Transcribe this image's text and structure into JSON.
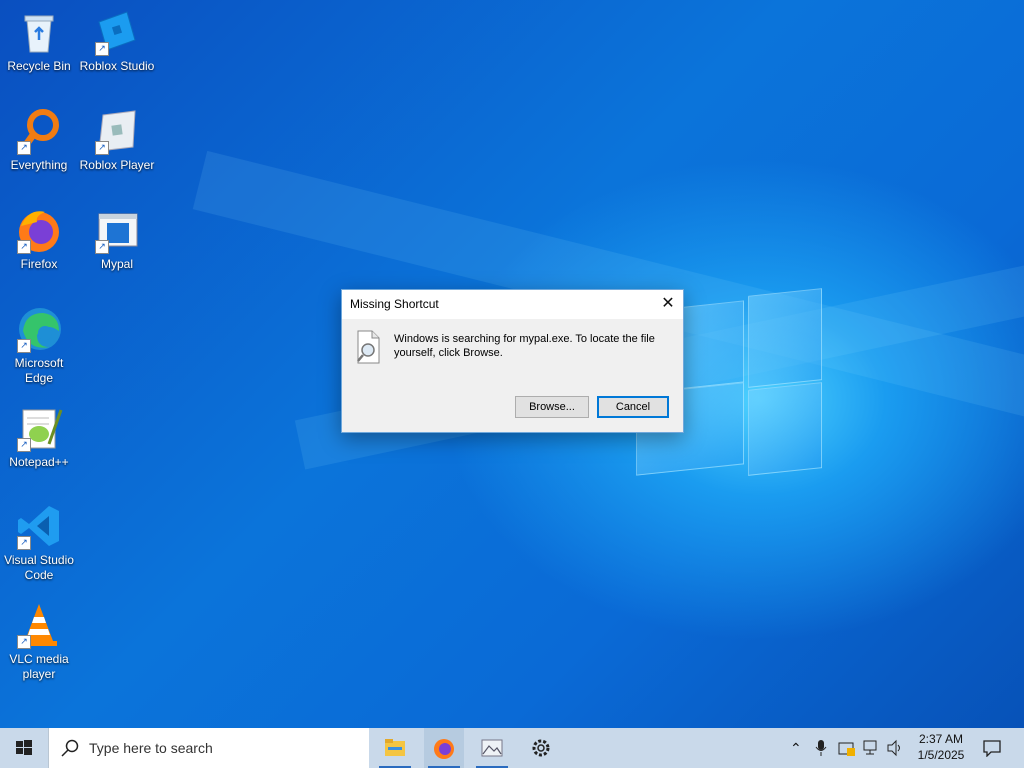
{
  "desktop_icons": [
    {
      "label": "Recycle Bin",
      "icon": "recycle-bin-icon"
    },
    {
      "label": "Roblox Studio",
      "icon": "roblox-studio-icon"
    },
    {
      "label": "Everything",
      "icon": "everything-icon"
    },
    {
      "label": "Roblox Player",
      "icon": "roblox-player-icon"
    },
    {
      "label": "Firefox",
      "icon": "firefox-icon"
    },
    {
      "label": "Mypal",
      "icon": "mypal-icon"
    },
    {
      "label": "Microsoft Edge",
      "icon": "edge-icon"
    },
    {
      "label": "Notepad++",
      "icon": "notepadpp-icon"
    },
    {
      "label": "Visual Studio Code",
      "icon": "vscode-icon"
    },
    {
      "label": "VLC media player",
      "icon": "vlc-icon"
    }
  ],
  "dialog": {
    "title": "Missing Shortcut",
    "close_glyph": "✕",
    "message": "Windows is searching for mypal.exe. To locate the file yourself, click Browse.",
    "browse_label": "Browse...",
    "cancel_label": "Cancel"
  },
  "taskbar": {
    "search_placeholder": "Type here to search",
    "apps": [
      "file-explorer-icon",
      "firefox-icon",
      "photos-icon",
      "settings-icon"
    ],
    "tray": {
      "time": "2:37 AM",
      "date": "1/5/2025"
    }
  },
  "colors": {
    "accent": "#0078d7",
    "taskbar": "#c9d9ea",
    "dialog_bg": "#f0f0f0"
  }
}
